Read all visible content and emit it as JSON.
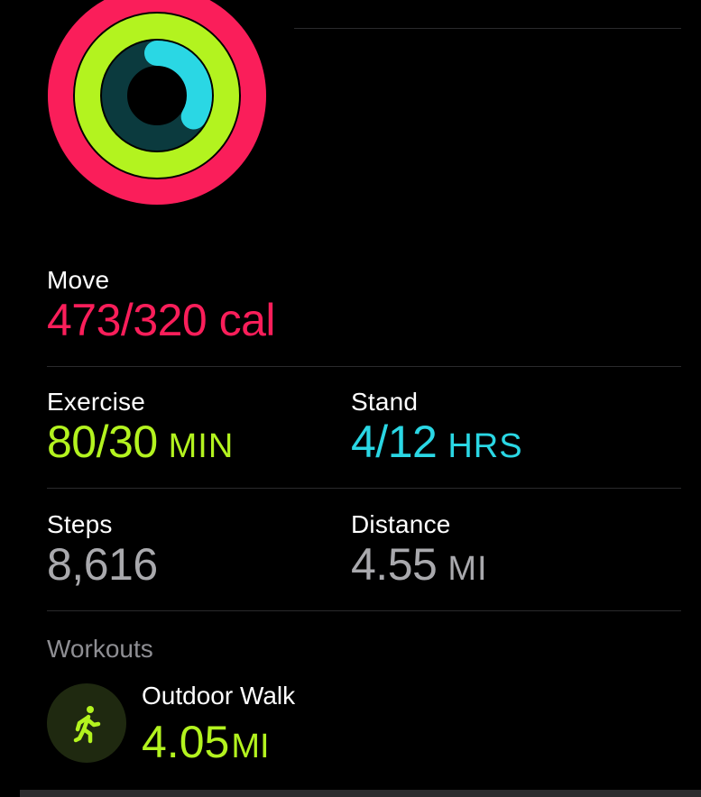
{
  "rings": {
    "move_progress": 1.478,
    "exercise_progress": 2.667,
    "stand_progress": 0.333,
    "colors": {
      "move": "#fa1e5a",
      "exercise": "#b3f31f",
      "stand": "#2ad7e4"
    }
  },
  "move": {
    "label": "Move",
    "value": "473/320 cal",
    "color": "#fa1e5a"
  },
  "exercise": {
    "label": "Exercise",
    "value": "80/30",
    "unit": "MIN",
    "color": "#b3f31f"
  },
  "stand": {
    "label": "Stand",
    "value": "4/12",
    "unit": "HRS",
    "color": "#2ad7e4"
  },
  "steps": {
    "label": "Steps",
    "value": "8,616",
    "color": "#a9a9ad"
  },
  "distance": {
    "label": "Distance",
    "value": "4.55",
    "unit": "MI",
    "color": "#a9a9ad"
  },
  "workouts": {
    "title": "Workouts",
    "items": [
      {
        "name": "Outdoor Walk",
        "value": "4.05",
        "unit": "MI",
        "icon": "walking-figure-icon",
        "color": "#b3f31f"
      }
    ]
  }
}
